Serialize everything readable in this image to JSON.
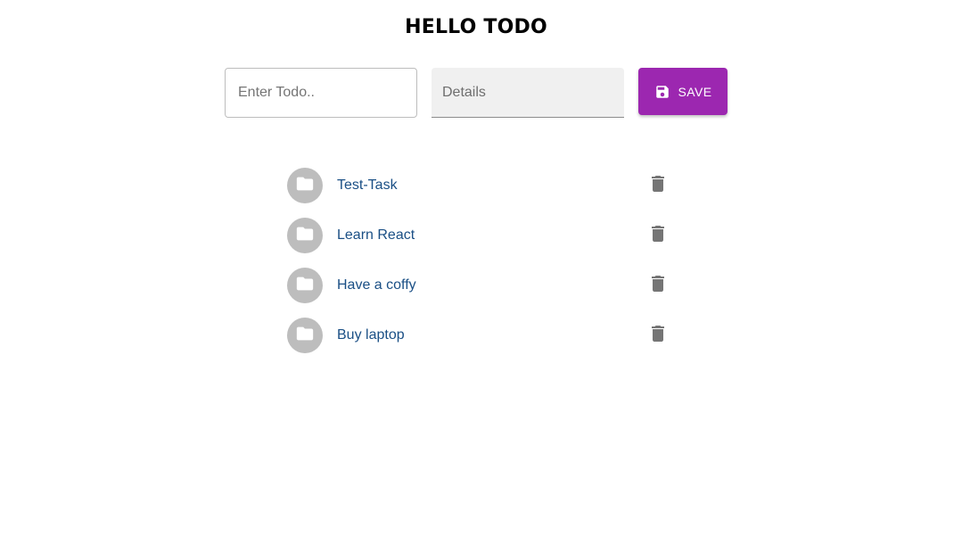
{
  "header": {
    "title": "HELLO TODO"
  },
  "form": {
    "todo_placeholder": "Enter Todo..",
    "todo_value": "",
    "details_placeholder": "Details",
    "details_value": "",
    "save_label": "SAVE"
  },
  "todos": [
    {
      "label": "Test-Task",
      "icon": "folder-icon"
    },
    {
      "label": "Learn React",
      "icon": "folder-icon"
    },
    {
      "label": "Have a coffy",
      "icon": "folder-icon"
    },
    {
      "label": "Buy laptop",
      "icon": "folder-icon"
    }
  ],
  "icons": {
    "save": "save-icon",
    "delete": "trash-icon"
  },
  "colors": {
    "accent": "#9c27b0",
    "avatar": "#bdbdbd",
    "item_text": "#1a4f85",
    "delete_icon": "#757575"
  }
}
